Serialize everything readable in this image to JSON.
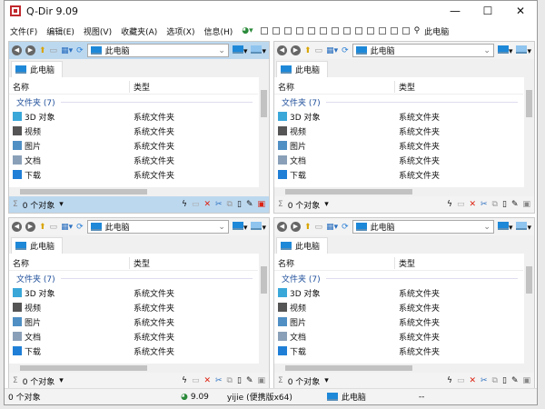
{
  "window": {
    "title": "Q-Dir 9.09",
    "minimize": "—",
    "maximize": "☐",
    "close": "✕"
  },
  "menu": [
    "文件(F)",
    "编辑(E)",
    "视图(V)",
    "收藏夹(A)",
    "选项(X)",
    "信息(H)"
  ],
  "menu_right_label": "此电脑",
  "panes": [
    {
      "address": "此电脑",
      "tab": "此电脑",
      "col_name": "名称",
      "col_type": "类型",
      "group": "文件夹 (7)",
      "items": [
        {
          "name": "3D 对象",
          "type": "系统文件夹",
          "icon": "3d-objects-icon"
        },
        {
          "name": "视频",
          "type": "系统文件夹",
          "icon": "video-icon"
        },
        {
          "name": "图片",
          "type": "系统文件夹",
          "icon": "pictures-icon"
        },
        {
          "name": "文档",
          "type": "系统文件夹",
          "icon": "documents-icon"
        },
        {
          "name": "下载",
          "type": "系统文件夹",
          "icon": "download-icon"
        }
      ],
      "status": "0 个对象",
      "active": true
    },
    {
      "address": "此电脑",
      "tab": "此电脑",
      "col_name": "名称",
      "col_type": "类型",
      "group": "文件夹 (7)",
      "items": [
        {
          "name": "3D 对象",
          "type": "系统文件夹",
          "icon": "3d-objects-icon"
        },
        {
          "name": "视频",
          "type": "系统文件夹",
          "icon": "video-icon"
        },
        {
          "name": "图片",
          "type": "系统文件夹",
          "icon": "pictures-icon"
        },
        {
          "name": "文档",
          "type": "系统文件夹",
          "icon": "documents-icon"
        },
        {
          "name": "下载",
          "type": "系统文件夹",
          "icon": "download-icon"
        }
      ],
      "status": "0 个对象",
      "active": false
    },
    {
      "address": "此电脑",
      "tab": "此电脑",
      "col_name": "名称",
      "col_type": "类型",
      "group": "文件夹 (7)",
      "items": [
        {
          "name": "3D 对象",
          "type": "系统文件夹",
          "icon": "3d-objects-icon"
        },
        {
          "name": "视频",
          "type": "系统文件夹",
          "icon": "video-icon"
        },
        {
          "name": "图片",
          "type": "系统文件夹",
          "icon": "pictures-icon"
        },
        {
          "name": "文档",
          "type": "系统文件夹",
          "icon": "documents-icon"
        },
        {
          "name": "下载",
          "type": "系统文件夹",
          "icon": "download-icon"
        }
      ],
      "status": "0 个对象",
      "active": false
    },
    {
      "address": "此电脑",
      "tab": "此电脑",
      "col_name": "名称",
      "col_type": "类型",
      "group": "文件夹 (7)",
      "items": [
        {
          "name": "3D 对象",
          "type": "系统文件夹",
          "icon": "3d-objects-icon"
        },
        {
          "name": "视频",
          "type": "系统文件夹",
          "icon": "video-icon"
        },
        {
          "name": "图片",
          "type": "系统文件夹",
          "icon": "pictures-icon"
        },
        {
          "name": "文档",
          "type": "系统文件夹",
          "icon": "documents-icon"
        },
        {
          "name": "下载",
          "type": "系统文件夹",
          "icon": "download-icon"
        }
      ],
      "status": "0 个对象",
      "active": false
    }
  ],
  "statusbar": {
    "objects": "0 个对象",
    "version": "9.09",
    "user": "yijie (便携版x64)",
    "location": "此电脑",
    "extra": "--"
  },
  "icon_colors": {
    "3d-objects-icon": "#3aa7d9",
    "video-icon": "#555555",
    "pictures-icon": "#4f8fc4",
    "documents-icon": "#8aa0b8",
    "download-icon": "#1f7fd6"
  }
}
